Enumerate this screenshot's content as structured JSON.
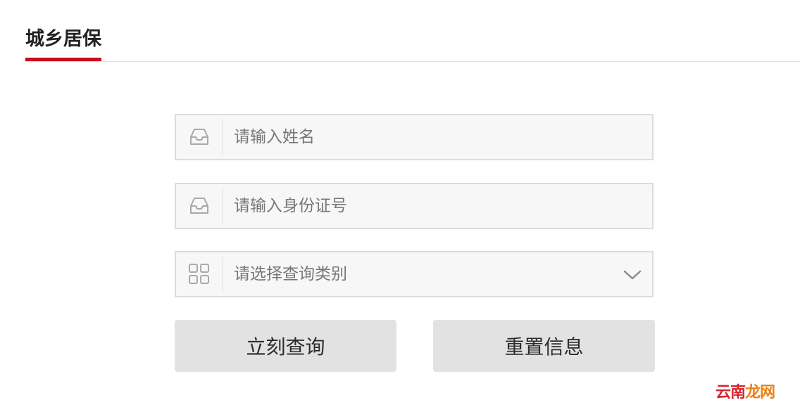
{
  "header": {
    "title": "城乡居保",
    "accent_color": "#c80e1a"
  },
  "form": {
    "name_field": {
      "placeholder": "请输入姓名",
      "value": "",
      "icon": "inbox-icon"
    },
    "id_field": {
      "placeholder": "请输入身份证号",
      "value": "",
      "icon": "inbox-icon"
    },
    "category_select": {
      "placeholder": "请选择查询类别",
      "icon": "grid-icon",
      "dropdown_icon": "chevron-down-icon"
    },
    "query_button_label": "立刻查询",
    "reset_button_label": "重置信息"
  },
  "watermark": {
    "part1": "云",
    "part2": "南",
    "part3": "龙",
    "part4": "网"
  }
}
